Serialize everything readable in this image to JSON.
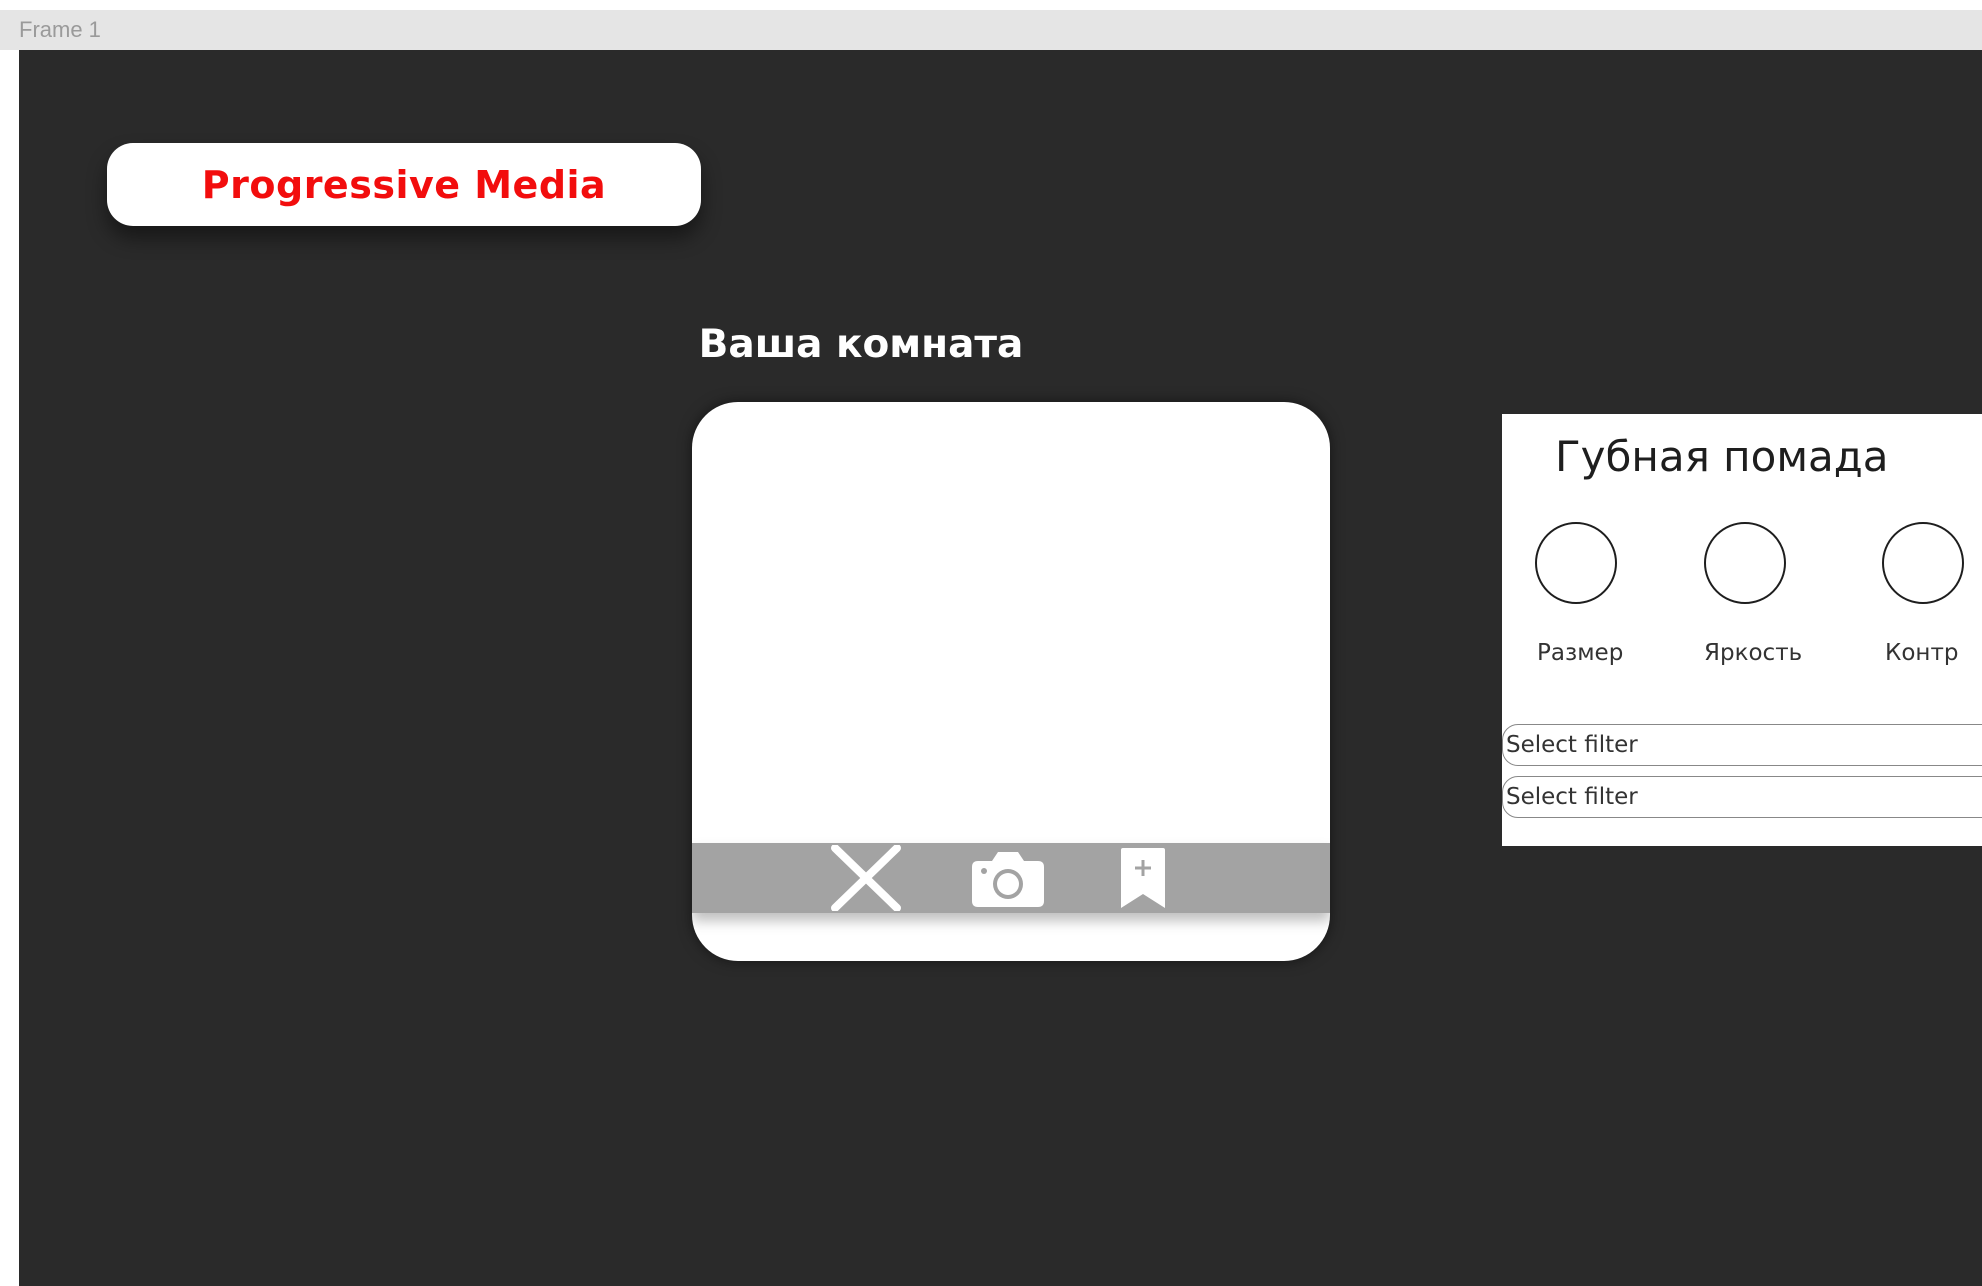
{
  "window": {
    "frame_label": "Frame 1"
  },
  "logo": {
    "text": "Progressive Media",
    "color": "#f20d0d"
  },
  "room": {
    "title": "Ваша комната",
    "toolbar": {
      "close_icon": "close-icon",
      "camera_icon": "camera-icon",
      "bookmark_icon": "bookmark-add-icon"
    }
  },
  "panel": {
    "title": "Губная помада",
    "controls": [
      {
        "label": "Размер"
      },
      {
        "label": "Яркость"
      },
      {
        "label": "Контр"
      }
    ],
    "selects": [
      {
        "value": "Select filter"
      },
      {
        "value": "Select filter"
      }
    ]
  },
  "colors": {
    "canvas_bg": "#2a2a2a",
    "toolbar_bg": "#a3a3a3",
    "topbar_bg": "#e5e5e5"
  }
}
